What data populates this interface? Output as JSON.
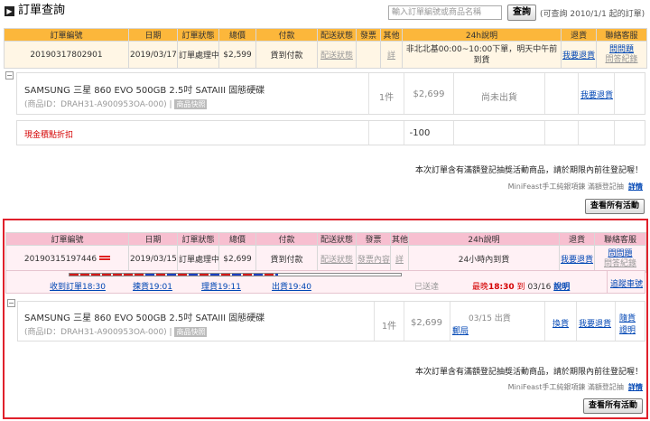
{
  "header": {
    "icon": "▶",
    "title": "訂單查詢",
    "search_placeholder": "輸入訂單編號或商品名稱",
    "search_button": "查詢",
    "search_note": "(可查詢 2010/1/1 起的訂單)"
  },
  "columns": [
    "訂單編號",
    "日期",
    "訂單狀態",
    "總價",
    "付款",
    "配送狀態",
    "發票",
    "其他",
    "24h說明",
    "退貨",
    "聯絡客服"
  ],
  "order1": {
    "id": "20190317802901",
    "date": "2019/03/17",
    "status": "訂單處理中",
    "total": "$2,599",
    "payment": "貨到付款",
    "shipping": "配送狀態",
    "invoice": "",
    "other": "詳",
    "note_24h": "非北北基00:00~10:00下單，明天中午前到貨",
    "return": "我要退貨",
    "contact_1": "問問題",
    "contact_2": "問答紀錄",
    "item": {
      "name": "SAMSUNG 三星 860 EVO 500GB 2.5吋 SATAIII 固態硬碟",
      "id": "(商品ID：DRAH31-A900953OA-000) |",
      "snapshot": "商品快照",
      "qty": "1件",
      "price": "$2,699",
      "status": "尚未出貨",
      "return": "我要退貨"
    },
    "discount": {
      "label": "現金積點折扣",
      "value": "-100"
    },
    "notice": "本次訂單含有滿額登記抽獎活動商品，請於期限內前往登記喔！",
    "promo": "MiniFeast手工純銀項鍊 滿額登記抽",
    "promo_link": "詳情",
    "activity_button": "查看所有活動"
  },
  "order2": {
    "id": "20190315197446",
    "date": "2019/03/15",
    "status": "訂單處理中",
    "total": "$2,699",
    "payment": "貨到付款",
    "shipping": "配送狀態",
    "invoice": "發票內容",
    "other": "詳",
    "note_24h": "24小時內到貨",
    "return": "我要退貨",
    "contact_1": "問問題",
    "contact_2": "問答紀錄",
    "progress": {
      "steps": [
        "收到訂單18:30",
        "揀貨19:01",
        "理貨19:11",
        "出貨19:40",
        "已送達"
      ],
      "fill_fraction": 0.63,
      "eta_prefix": "最晚",
      "eta_time": "18:30",
      "eta_mid": "到",
      "eta_date": "03/16",
      "eta_link": "說明",
      "track_link": "追蹤車號"
    },
    "item": {
      "name": "SAMSUNG 三星 860 EVO 500GB 2.5吋 SATAIII 固態硬碟",
      "id": "(商品ID：DRAH31-A900953OA-000) |",
      "snapshot": "商品快照",
      "qty": "1件",
      "price": "$2,699",
      "ship_date": "03/15 出貨",
      "carrier": "郵局",
      "exchange": "換貨",
      "return": "我要退貨",
      "hint_1": "隨貨",
      "hint_2": "證明"
    },
    "notice": "本次訂單含有滿額登記抽獎活動商品，請於期限內前往登記喔！",
    "promo": "MiniFeast手工純銀項鍊 滿額登記抽",
    "promo_link": "詳情",
    "activity_button": "查看所有活動"
  },
  "colors": {
    "order1_header": "#fcb73b",
    "order2_header": "#f7bfd0",
    "frame": "#e0202b",
    "link": "#0046b4",
    "alert": "#d40000"
  }
}
